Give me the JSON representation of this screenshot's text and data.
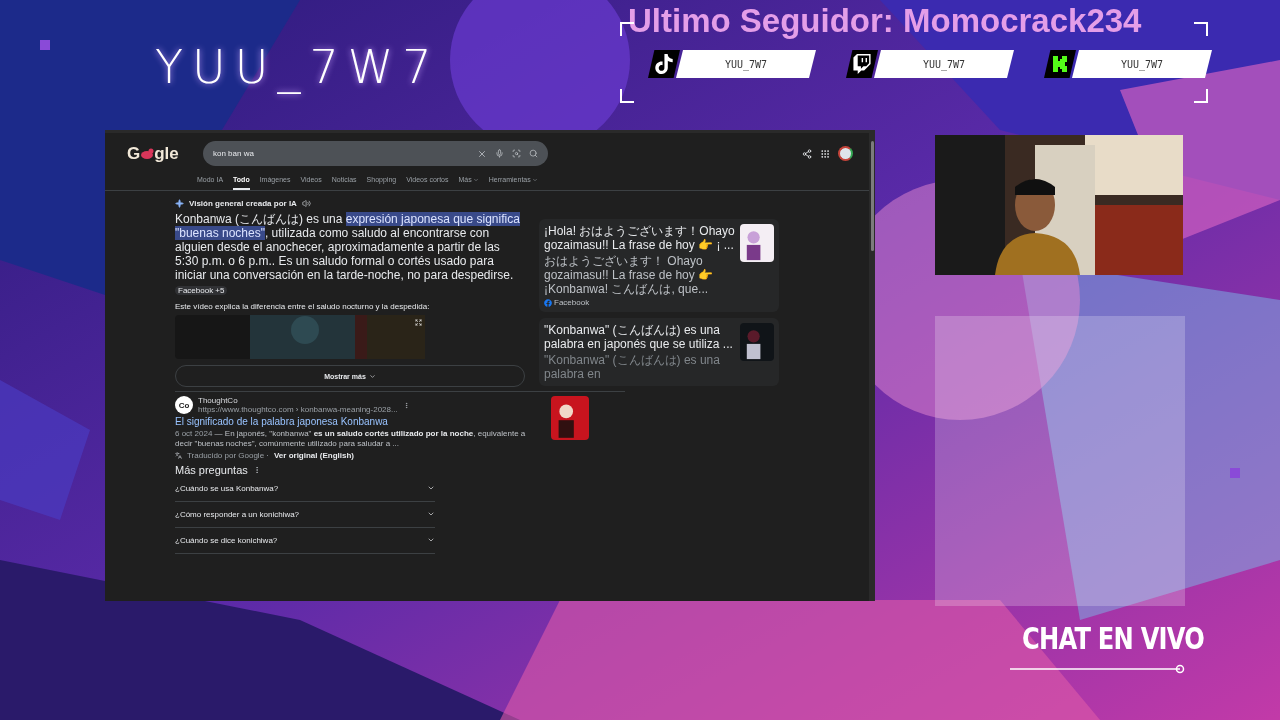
{
  "overlay": {
    "channel_name": "YUU_7W7",
    "last_follower": "Ultimo Seguidor: Momocrack234",
    "socials": [
      {
        "kind": "tiktok",
        "handle": "YUU_7W7"
      },
      {
        "kind": "twitch",
        "handle": "YUU_7W7"
      },
      {
        "kind": "kick",
        "handle": "YUU_7W7"
      }
    ],
    "chat_title": "CHAT EN VIVO"
  },
  "browser": {
    "logo": [
      "G",
      "gle"
    ],
    "search": {
      "value": "kon ban wa"
    },
    "tabs": [
      {
        "label": "Modo IA",
        "kind": "link",
        "selected": false
      },
      {
        "label": "Todo",
        "kind": "link",
        "selected": true
      },
      {
        "label": "Imágenes",
        "kind": "link",
        "selected": false
      },
      {
        "label": "Videos",
        "kind": "link",
        "selected": false
      },
      {
        "label": "Noticias",
        "kind": "link",
        "selected": false
      },
      {
        "label": "Shopping",
        "kind": "link",
        "selected": false
      },
      {
        "label": "Videos cortos",
        "kind": "link",
        "selected": false
      },
      {
        "label": "Más",
        "kind": "menu",
        "selected": false
      },
      {
        "label": "Herramientas",
        "kind": "menu",
        "selected": false
      }
    ],
    "ai_overview": {
      "heading": "Visión general creada por IA",
      "text_before": "Konbanwa (こんばんは) es una ",
      "highlight": "expresión japonesa que significa \"buenas noches\"",
      "text_after": ", utilizada como saludo al encontrarse con alguien desde el anochecer, aproximadamente a partir de las 5:30 p.m. o 6 p.m.. Es un saludo formal o cortés usado para iniciar una conversación en la tarde-noche, no para despedirse.",
      "source_chip": "Facebook +5",
      "video_label": "Este vídeo explica la diferencia entre el saludo nocturno y la despedida:",
      "show_more": "Mostrar más",
      "cards": [
        {
          "title": "¡Hola! おはようございます！Ohayo gozaimasu!! La frase de hoy 👉 ¡ ...",
          "snippet": "おはようございます！ Ohayo gozaimasu!! La frase de hoy 👉 ¡Konbanwa! こんばんは, que...",
          "source": "Facebook"
        },
        {
          "title": "\"Konbanwa\" (こんばんは) es una palabra en japonés que se utiliza ...",
          "snippet": "\"Konbanwa\" (こんばんは) es una palabra en"
        }
      ]
    },
    "result": {
      "favicon": "Co",
      "site": "ThoughtCo",
      "url": "https://www.thoughtco.com › konbanwa-meaning-2028...",
      "title": "El significado de la palabra japonesa Konbanwa",
      "date": "6 oct 2024",
      "snippet": " — En japonés, \"konbanwa\" **es un saludo cortés utilizado por la noche**, equivalente a decir \"buenas noches\", comúnmente utilizado para saludar a ...",
      "translated": "Traducido por Google ·",
      "original_link": "Ver original (English)"
    },
    "questions": {
      "heading": "Más preguntas",
      "items": [
        {
          "text": "¿Cuándo se usa Konbanwa?",
          "expanded": false
        },
        {
          "text": "¿Cómo responder a un konichiwa?",
          "expanded": false
        },
        {
          "text": "¿Cuándo se dice konichiwa?",
          "expanded": false
        }
      ]
    }
  }
}
